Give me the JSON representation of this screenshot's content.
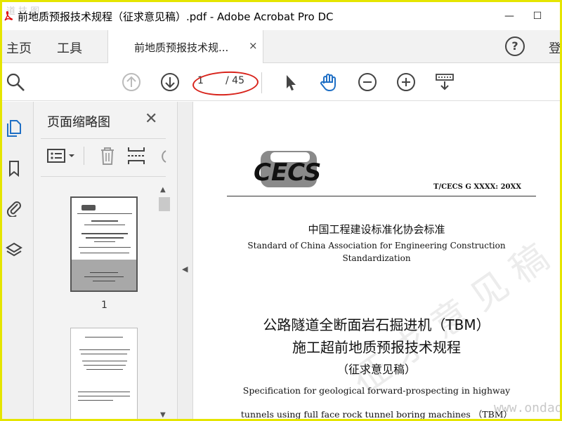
{
  "window": {
    "title": "前地质预报技术规程（征求意见稿）.pdf - Adobe Acrobat Pro DC",
    "watermark": "道 技 图",
    "minimize": "—",
    "maximize": "☐"
  },
  "nav": {
    "home": "主页",
    "tools": "工具",
    "tab_label": "前地质预报技术规...",
    "tab_close": "×",
    "help": "?",
    "signin": "登"
  },
  "toolbar": {
    "page_current": "1",
    "page_total": "/ 45",
    "annotation_color": "#d8231b"
  },
  "panel": {
    "title": "页面缩略图",
    "close": "✕",
    "thumbnails": [
      {
        "label": "1"
      }
    ]
  },
  "document": {
    "logo_text": "CECS",
    "standard_code": "T/CECS G XXXX: 20XX",
    "org_cn": "中国工程建设标准化协会标准",
    "org_en_line1": "Standard of China Association for Engineering Construction",
    "org_en_line2": "Standardization",
    "title_cn_line1": "公路隧道全断面岩石掘进机（TBM）",
    "title_cn_line2": "施工超前地质预报技术规程",
    "subtitle_cn": "（征求意见稿）",
    "title_en_line1": "Specification for geological forward-prospecting in highway",
    "title_en_line2": "tunnels using full face rock tunnel boring machines （TBM）",
    "stamp": "征 求 意 见 稿"
  },
  "site_watermark": "www.ondao.com"
}
